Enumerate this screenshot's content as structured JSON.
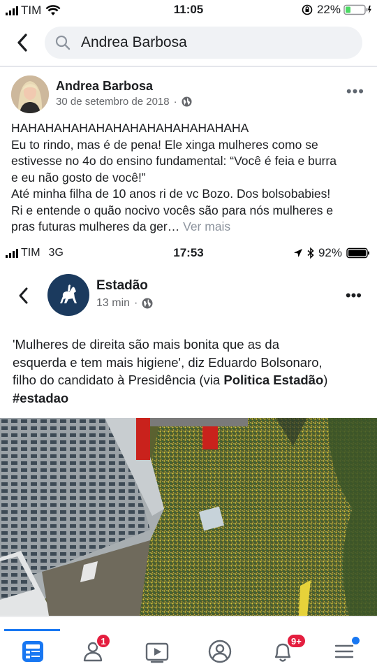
{
  "status_bar": {
    "carrier": "TIM",
    "time": "11:05",
    "battery": "22%"
  },
  "search": {
    "query": "Andrea Barbosa"
  },
  "post": {
    "author": "Andrea Barbosa",
    "date": "30 de setembro de 2018",
    "separator": "·",
    "lines": [
      "HAHAHAHAHAHAHAHAHAHAHAHAHAHA",
      "Eu to rindo, mas é de pena! Ele xinga mulheres como se",
      "estivesse no 4o do ensino fundamental: “Você é feia e burra",
      "e eu não gosto de você!”",
      "Até minha filha de 10 anos ri de vc Bozo. Dos bolsobabies!",
      "Ri e entende o quão nocivo vocês são para nós mulheres e",
      "pras futuras mulheres da ger…"
    ],
    "see_more": "Ver mais"
  },
  "embedded": {
    "status_bar": {
      "carrier": "TIM",
      "network": "3G",
      "time": "17:53",
      "battery": "92%"
    },
    "page_name": "Estadão",
    "time_ago": "13 min",
    "separator": "·",
    "text_lines": [
      "'Mulheres de direita são mais bonita que as da",
      "esquerda e tem mais higiene', diz Eduardo Bolsonaro,"
    ],
    "text_line3_prefix": "filho do candidato à Presidência (via ",
    "text_line3_bold": "Politica Estadão",
    "text_line3_suffix": ")",
    "hashtag": "#estadao"
  },
  "nav": {
    "friends_badge": "1",
    "notifications_badge": "9+",
    "accent_color": "#1877f2"
  }
}
